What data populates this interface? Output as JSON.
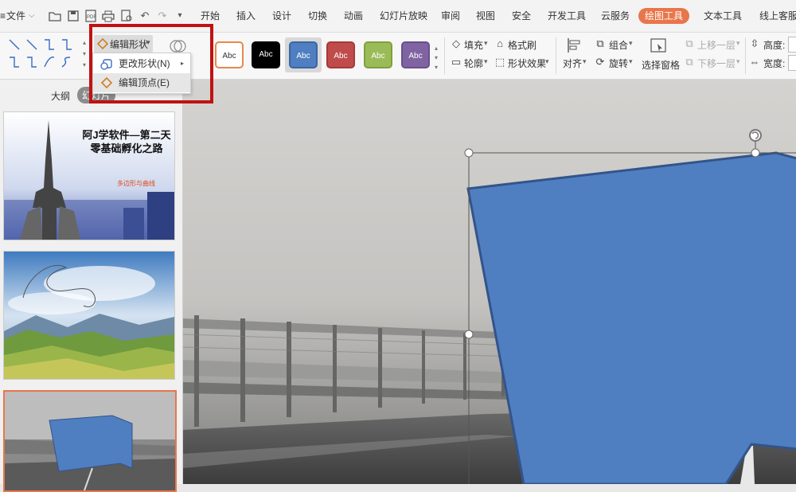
{
  "menubar": {
    "file_label": "文件",
    "file_icon": "hamburger-icon",
    "quick_access": [
      "folder-icon",
      "save-icon",
      "pdf-icon",
      "print-icon",
      "print-preview-icon",
      "undo-icon",
      "redo-icon",
      "more-icon"
    ],
    "tabs": [
      "开始",
      "插入",
      "设计",
      "切换",
      "动画",
      "幻灯片放映",
      "审阅",
      "视图",
      "安全",
      "开发工具",
      "云服务",
      "绘图工具",
      "文本工具",
      "线上客服"
    ],
    "active_tab": "绘图工具",
    "accent_color": "#e8764a"
  },
  "ribbon": {
    "edit_shape_label": "编辑形状",
    "shape_styles": [
      {
        "label": "Abc",
        "fill": "#ffffff",
        "border": "#e8884a",
        "text": "#333333"
      },
      {
        "label": "Abc",
        "fill": "#000000",
        "border": "#000000",
        "text": "#ffffff"
      },
      {
        "label": "Abc",
        "fill": "#4f7fc0",
        "border": "#3a66a3",
        "text": "#ffffff"
      },
      {
        "label": "Abc",
        "fill": "#c04b4b",
        "border": "#a63a3a",
        "text": "#ffffff"
      },
      {
        "label": "Abc",
        "fill": "#9bbb59",
        "border": "#7ea03f",
        "text": "#ffffff"
      },
      {
        "label": "Abc",
        "fill": "#8064a2",
        "border": "#6a4f8c",
        "text": "#ffffff"
      }
    ],
    "fill_label": "填充",
    "format_brush_label": "格式刷",
    "outline_label": "轮廓",
    "shape_effect_label": "形状效果",
    "align_label": "对齐",
    "group_label": "组合",
    "rotate_label": "旋转",
    "selection_pane_label": "选择窗格",
    "bring_forward_label": "上移一层",
    "send_backward_label": "下移一层",
    "height_label": "高度:",
    "width_label": "宽度:"
  },
  "dropdown": {
    "items": [
      {
        "label": "更改形状(N)",
        "icon": "change-shape-icon"
      },
      {
        "label": "编辑顶点(E)",
        "icon": "edit-points-icon"
      }
    ]
  },
  "leftpanel": {
    "tabs": [
      "大纲",
      "幻灯片"
    ],
    "active_tab": "幻灯片",
    "slide1": {
      "title_line1": "阿J学软件—第二天",
      "title_line2": "零基础孵化之路",
      "subtitle": "多边形与曲线"
    }
  }
}
